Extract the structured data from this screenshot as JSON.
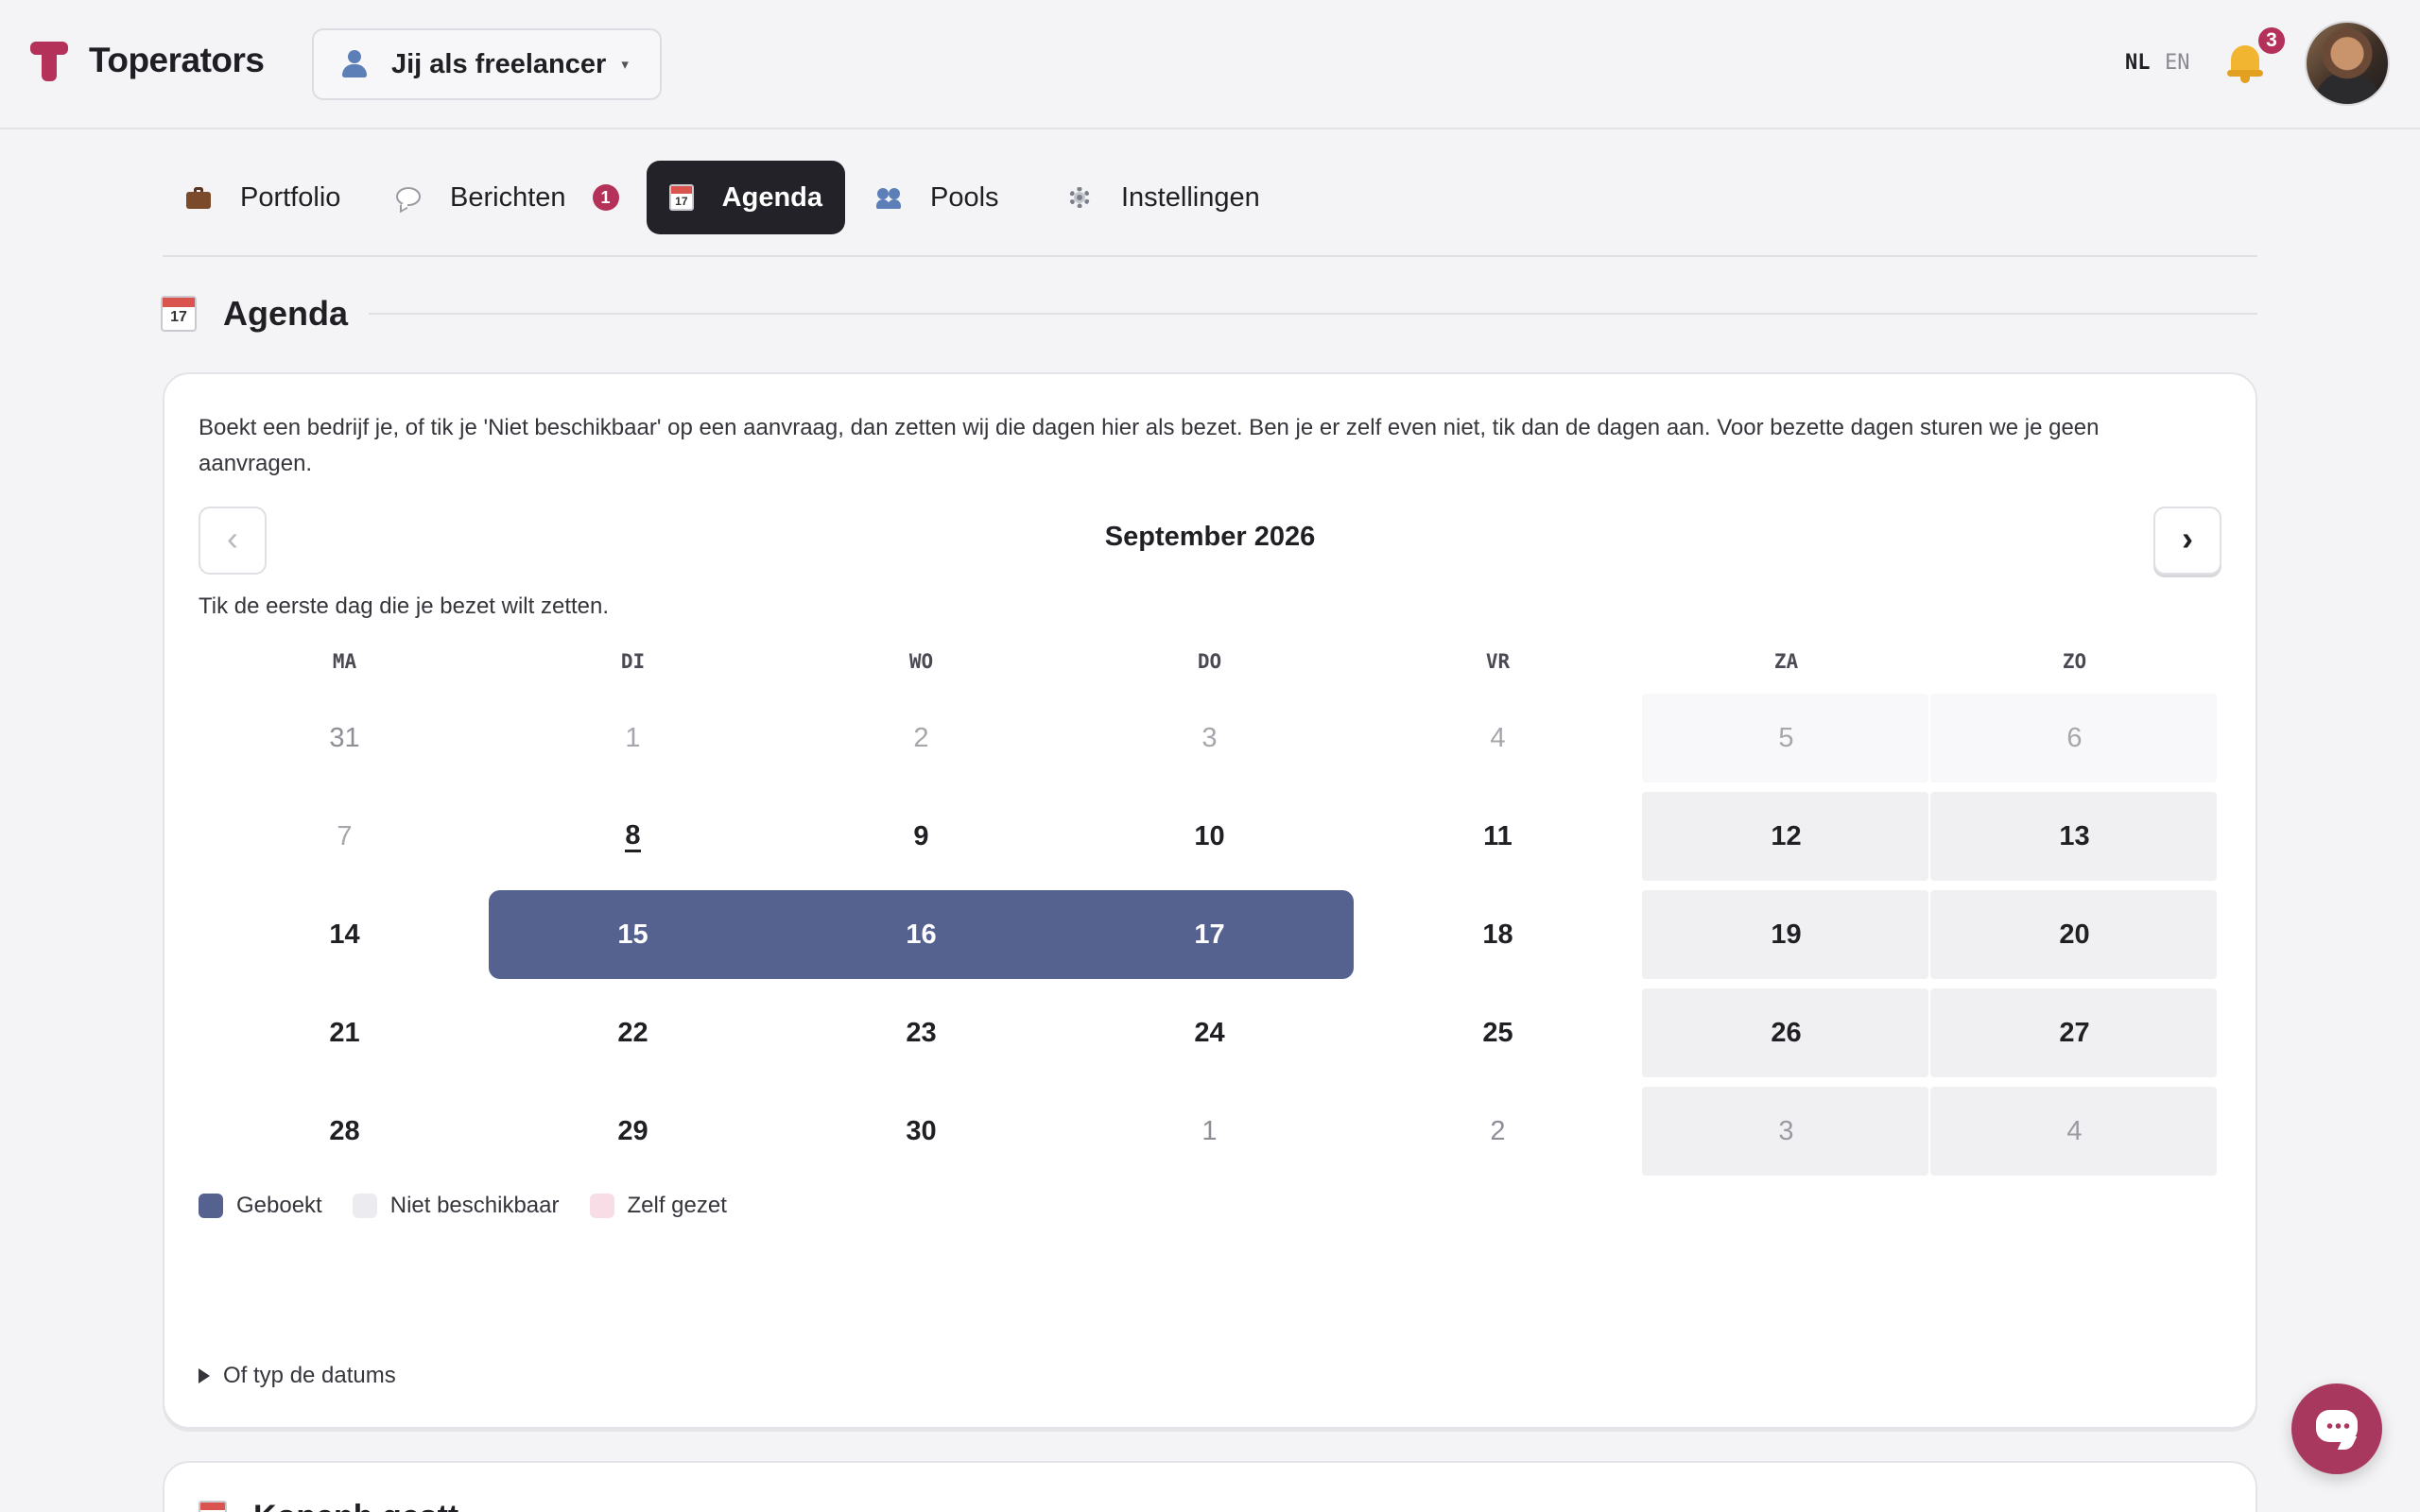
{
  "app": {
    "name": "Toperators"
  },
  "role_selector": {
    "label": "Jij als freelancer",
    "icon": "user-icon"
  },
  "languages": {
    "active": "NL",
    "other": "EN"
  },
  "notifications": {
    "count": "3",
    "icon": "bell-icon"
  },
  "tabs": [
    {
      "label": "Portfolio",
      "icon": "briefcase-icon"
    },
    {
      "label": "Berichten",
      "icon": "speech-bubble-icon",
      "count": "1"
    },
    {
      "label": "Agenda",
      "icon": "calendar-icon",
      "active": true
    },
    {
      "label": "Pools",
      "icon": "people-icon"
    },
    {
      "label": "Instellingen",
      "icon": "gear-icon"
    }
  ],
  "calendar_icon_day": "17",
  "section": {
    "title": "Agenda"
  },
  "agenda": {
    "intro": "Boekt een bedrijf je, of tik je 'Niet beschikbaar' op een aanvraag, dan zetten wij die dagen hier als bezet. Ben je er zelf even niet, tik dan de dagen aan. Voor bezette dagen sturen we je geen aanvragen.",
    "prev_label": "‹",
    "next_label": "›",
    "month": "September 2026",
    "hint": "Tik de eerste dag die je bezet wilt zetten.",
    "weekdays": [
      "MA",
      "DI",
      "WO",
      "DO",
      "VR",
      "ZA",
      "ZO"
    ],
    "weeks": [
      [
        "31",
        "1",
        "2",
        "3",
        "4",
        "5",
        "6"
      ],
      [
        "7",
        "8",
        "9",
        "10",
        "11",
        "12",
        "13"
      ],
      [
        "14",
        "15",
        "16",
        "17",
        "18",
        "19",
        "20"
      ],
      [
        "21",
        "22",
        "23",
        "24",
        "25",
        "26",
        "27"
      ],
      [
        "28",
        "29",
        "30",
        "1",
        "2",
        "3",
        "4"
      ]
    ],
    "today": "8",
    "booked_days": [
      "15",
      "16",
      "17"
    ],
    "legend": [
      {
        "label": "Geboekt",
        "color": "#556290"
      },
      {
        "label": "Niet beschikbaar",
        "color": "#ececf0"
      },
      {
        "label": "Zelf gezet",
        "color": "#f9dde6"
      }
    ],
    "details_label": "Of typ de datums"
  },
  "next_section": {
    "title": "Kopenh gestt"
  },
  "colors": {
    "brand": "#b4315a",
    "booked": "#556290",
    "active_tab": "#222228"
  },
  "chat": {
    "icon": "chat-icon"
  }
}
